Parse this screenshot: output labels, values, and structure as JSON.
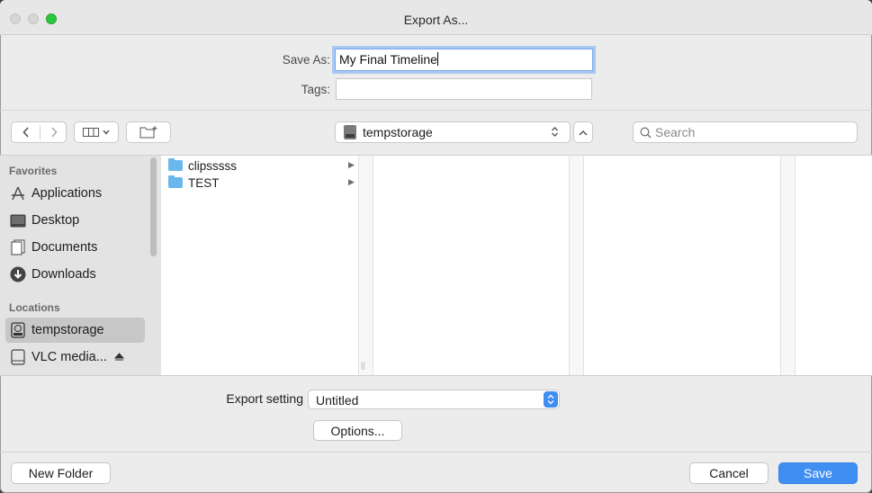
{
  "window": {
    "title": "Export As..."
  },
  "save_as": {
    "label": "Save As:",
    "value": "My Final Timeline"
  },
  "tags": {
    "label": "Tags:",
    "value": ""
  },
  "toolbar": {
    "back_icon": "chevron-left-icon",
    "forward_icon": "chevron-right-icon",
    "view_icon": "column-view-icon",
    "new_folder_icon": "folder-plus-icon",
    "location": "tempstorage",
    "search_placeholder": "Search"
  },
  "sidebar": {
    "favorites_header": "Favorites",
    "favorites": [
      {
        "label": "Applications",
        "icon": "applications-icon"
      },
      {
        "label": "Desktop",
        "icon": "desktop-icon"
      },
      {
        "label": "Documents",
        "icon": "documents-icon"
      },
      {
        "label": "Downloads",
        "icon": "downloads-icon"
      }
    ],
    "locations_header": "Locations",
    "locations": [
      {
        "label": "tempstorage",
        "icon": "disk-icon",
        "selected": true
      },
      {
        "label": "VLC media...",
        "icon": "external-drive-icon"
      }
    ]
  },
  "files": [
    {
      "name": "clipsssss",
      "type": "folder"
    },
    {
      "name": "TEST",
      "type": "folder"
    }
  ],
  "export": {
    "label": "Export setting",
    "value": "Untitled",
    "options_label": "Options..."
  },
  "footer": {
    "new_folder": "New Folder",
    "cancel": "Cancel",
    "save": "Save"
  },
  "colors": {
    "accent": "#3f8ef2",
    "green_light": "#2ac73e",
    "folder": "#6ab7ec",
    "sidebar_bg": "#e3e3e3"
  }
}
